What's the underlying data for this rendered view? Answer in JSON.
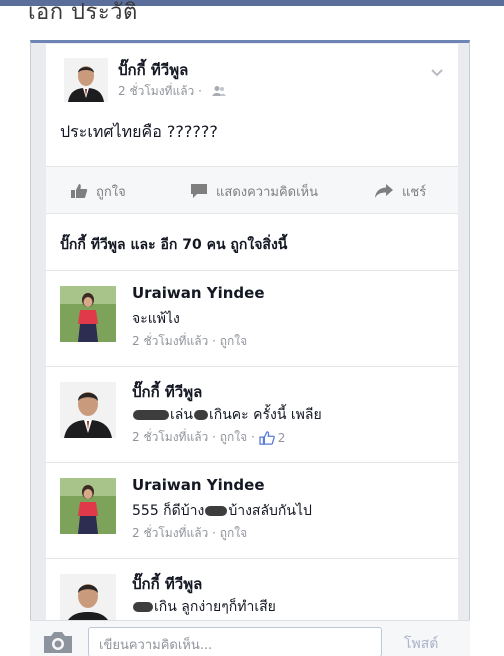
{
  "page": {
    "heading": "เอก ประวัติ"
  },
  "post": {
    "author": "ปั๊กกี้ ทีวีพูล",
    "meta": "2 ชั่วโมงที่แล้ว ·",
    "text": "ประเทศไทยคือ ??????"
  },
  "actions": {
    "like": "ถูกใจ",
    "comment": "แสดงความคิดเห็น",
    "share": "แชร์"
  },
  "likes_summary": "ปั๊กกี้ ทีวีพูล และ อีก 70 คน ถูกใจสิ่งนี้",
  "comments": [
    {
      "name": "Uraiwan Yindee",
      "text": "จะแพ้ไง",
      "meta": "2 ชั่วโมงที่แล้ว · ถูกใจ",
      "likes": ""
    },
    {
      "name": "ปั๊กกี้ ทีวีพูล",
      "text_parts": [
        "เล่น",
        "เกินคะ ครั้งนี้ เพลีย"
      ],
      "meta": "2 ชั่วโมงที่แล้ว · ถูกใจ ·",
      "likes": "2"
    },
    {
      "name": "Uraiwan Yindee",
      "text_parts": [
        "555 ก็ดีบ้าง",
        "บ้างสลับกันไป"
      ],
      "meta": "2 ชั่วโมงที่แล้ว · ถูกใจ",
      "likes": ""
    },
    {
      "name": "ปั๊กกี้ ทีวีพูล",
      "text_parts": [
        "",
        "เกิน ลูกง่ายๆก็ทำเสีย"
      ],
      "meta": "",
      "likes": ""
    }
  ],
  "composer": {
    "placeholder": "เขียนความคิดเห็น...",
    "post_label": "โพสต์"
  },
  "colors": {
    "accent": "#6d84b4",
    "text": "#141823",
    "meta": "#90949c",
    "action": "#7f7f7f"
  },
  "icons": {
    "like": "thumbs-up-icon",
    "comment": "speech-bubble-icon",
    "share": "share-arrow-icon",
    "audience": "friends-icon",
    "options": "chevron-down-icon",
    "camera": "camera-icon"
  }
}
